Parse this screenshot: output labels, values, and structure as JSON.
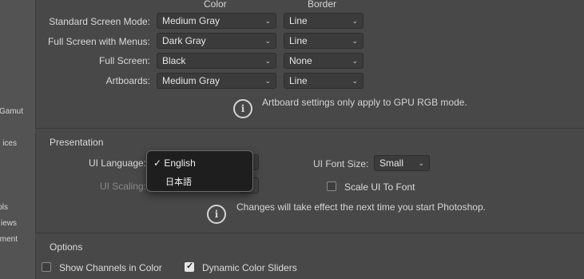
{
  "sidebar": {
    "items": [
      "Gamut",
      "ices",
      "ols",
      "iews",
      "ment"
    ]
  },
  "screen_modes": {
    "color_header": "Color",
    "border_header": "Border",
    "rows": [
      {
        "label": "Standard Screen Mode:",
        "color": "Medium Gray",
        "border": "Line"
      },
      {
        "label": "Full Screen with Menus:",
        "color": "Dark Gray",
        "border": "Line"
      },
      {
        "label": "Full Screen:",
        "color": "Black",
        "border": "None"
      },
      {
        "label": "Artboards:",
        "color": "Medium Gray",
        "border": "Line"
      }
    ],
    "info_note": "Artboard settings only apply to GPU RGB mode."
  },
  "presentation": {
    "title": "Presentation",
    "ui_language_label": "UI Language:",
    "ui_scaling_label": "UI Scaling:",
    "ui_font_size_label": "UI Font Size:",
    "ui_font_size_value": "Small",
    "scale_ui_label": "Scale UI To Font",
    "info_note": "Changes will take effect the next time you start Photoshop.",
    "language_menu": {
      "items": [
        {
          "label": "English",
          "checked": true
        },
        {
          "label": "日本語",
          "checked": false
        }
      ]
    }
  },
  "options": {
    "title": "Options",
    "show_channels_label": "Show Channels in Color",
    "show_channels_checked": false,
    "dynamic_sliders_label": "Dynamic Color Sliders",
    "dynamic_sliders_checked": true
  },
  "icons": {
    "info": "info-circle-icon",
    "chevron": "chevron-down-icon",
    "check": "checkmark-icon"
  },
  "colors": {
    "panel": "#484848",
    "background": "#535353",
    "select_bg": "#3b3b3b",
    "popup_bg": "#1e1e1e"
  }
}
